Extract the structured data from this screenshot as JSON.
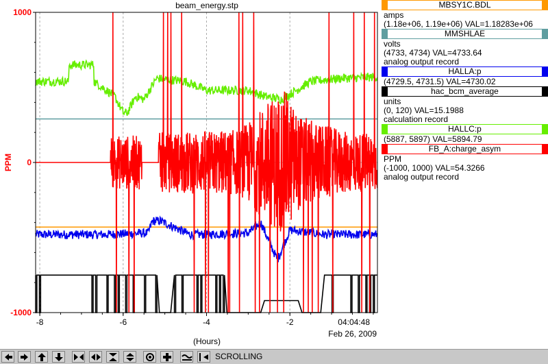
{
  "window": {
    "title": "beam_energy.stp"
  },
  "chart_data": {
    "type": "line",
    "title": "beam_energy.stp",
    "ylabel": "PPM",
    "xlabel": "(Hours)",
    "xlim": [
      -8.1,
      0.1
    ],
    "ylim": [
      -1000,
      1000
    ],
    "y_ticks": [
      "1000",
      "0",
      "-1000"
    ],
    "x_ticks": [
      "-8",
      "-6",
      "-4",
      "-2"
    ],
    "current_time": "04:04:48",
    "current_date": "Feb 26, 2009",
    "grid": true,
    "series": [
      {
        "name": "MBSY1C.BDL",
        "color": "#ff9900",
        "shape": "flat",
        "level": -430
      },
      {
        "name": "MMSHLAE",
        "color": "#5f9ea0",
        "shape": "flat",
        "level": 290
      },
      {
        "name": "HALLA:p",
        "color": "#0000ee",
        "shape": "noisy",
        "x": [
          -8.1,
          -6.4,
          -5.4,
          -5.3,
          -5.1,
          -4.4,
          -4.2,
          -3.0,
          -2.7,
          -2.3,
          -2.0,
          -1.2,
          0.1
        ],
        "y": [
          -480,
          -480,
          -470,
          -390,
          -390,
          -480,
          -480,
          -470,
          -400,
          -650,
          -450,
          -480,
          -480
        ]
      },
      {
        "name": "hac_bcm_average",
        "color": "#000000",
        "shape": "step",
        "x": [
          -8.1,
          -5.2,
          -5.2,
          -4.8,
          -4.8,
          -3.6,
          -3.6,
          -2.7,
          -2.7,
          -1.8,
          -1.8,
          -1.2,
          -1.2,
          0.1
        ],
        "y": [
          -750,
          -750,
          -1000,
          -1000,
          -750,
          -750,
          -1000,
          -1000,
          -920,
          -920,
          -1000,
          -1000,
          -750,
          -750
        ]
      },
      {
        "name": "HALLC:p",
        "color": "#66ee00",
        "shape": "noisy",
        "x": [
          -8.1,
          -7.3,
          -7.3,
          -6.7,
          -6.7,
          -6.2,
          -6.0,
          -5.9,
          -5.7,
          -5.5,
          -5.2,
          -4.5,
          -4.0,
          -3.0,
          -2.6,
          -2.2,
          -1.5,
          -0.8,
          0.1
        ],
        "y": [
          540,
          540,
          650,
          650,
          540,
          440,
          330,
          330,
          440,
          420,
          560,
          540,
          480,
          480,
          440,
          420,
          540,
          560,
          570
        ]
      },
      {
        "name": "FB_A:charge_asym",
        "color": "#ff0000",
        "shape": "burst",
        "x": [
          -8.1,
          -6.3,
          -6.3,
          -5.55,
          -5.55,
          -5.15,
          -5.15,
          -3.2,
          -2.9,
          -2.5,
          -2.1,
          -1.8,
          -1.3,
          -0.6,
          0.1
        ],
        "y": [
          0,
          0,
          0,
          0,
          0,
          0,
          0,
          0,
          0,
          0,
          0,
          0,
          0,
          0,
          0
        ],
        "amplitude": [
          0,
          0,
          180,
          180,
          0,
          0,
          200,
          220,
          300,
          420,
          480,
          320,
          260,
          200,
          200
        ]
      }
    ]
  },
  "legend": {
    "traces": [
      {
        "name": "MBSY1C.BDL",
        "color": "#ff9900",
        "lines": [
          "amps",
          "(1.18e+06, 1.19e+06)  VAL=1.18283e+06"
        ]
      },
      {
        "name": "MMSHLAE",
        "color": "#5f9ea0",
        "lines": [
          "volts",
          "(4733, 4734)  VAL=4733.64",
          "analog output record"
        ]
      },
      {
        "name": "HALLA:p",
        "color": "#0000ee",
        "lines": [
          "(4729.5, 4731.5)  VAL=4730.02"
        ]
      },
      {
        "name": "hac_bcm_average",
        "color": "#000000",
        "lines": [
          "units",
          "(0, 120)  VAL=15.1988",
          "calculation record"
        ]
      },
      {
        "name": "HALLC:p",
        "color": "#66ee00",
        "lines": [
          "(5887, 5897)  VAL=5894.79"
        ]
      },
      {
        "name": "FB_A:charge_asym",
        "color": "#ff0000",
        "lines": [
          "PPM",
          "(-1000, 1000)  VAL=54.3266",
          "analog output record"
        ]
      }
    ]
  },
  "toolbar": {
    "buttons": [
      {
        "icon": "pan-left-icon"
      },
      {
        "icon": "pan-right-icon"
      },
      {
        "icon": "pan-up-icon"
      },
      {
        "icon": "pan-down-icon"
      },
      {
        "icon": "zoom-in-x-icon"
      },
      {
        "icon": "zoom-out-x-icon"
      },
      {
        "icon": "zoom-in-y-icon"
      },
      {
        "icon": "zoom-out-y-icon"
      },
      {
        "icon": "zoom-box-icon"
      },
      {
        "icon": "pan-mode-icon"
      },
      {
        "icon": "auto-scale-icon"
      },
      {
        "icon": "undo-zoom-icon"
      }
    ],
    "mode_label": "SCROLLING"
  }
}
